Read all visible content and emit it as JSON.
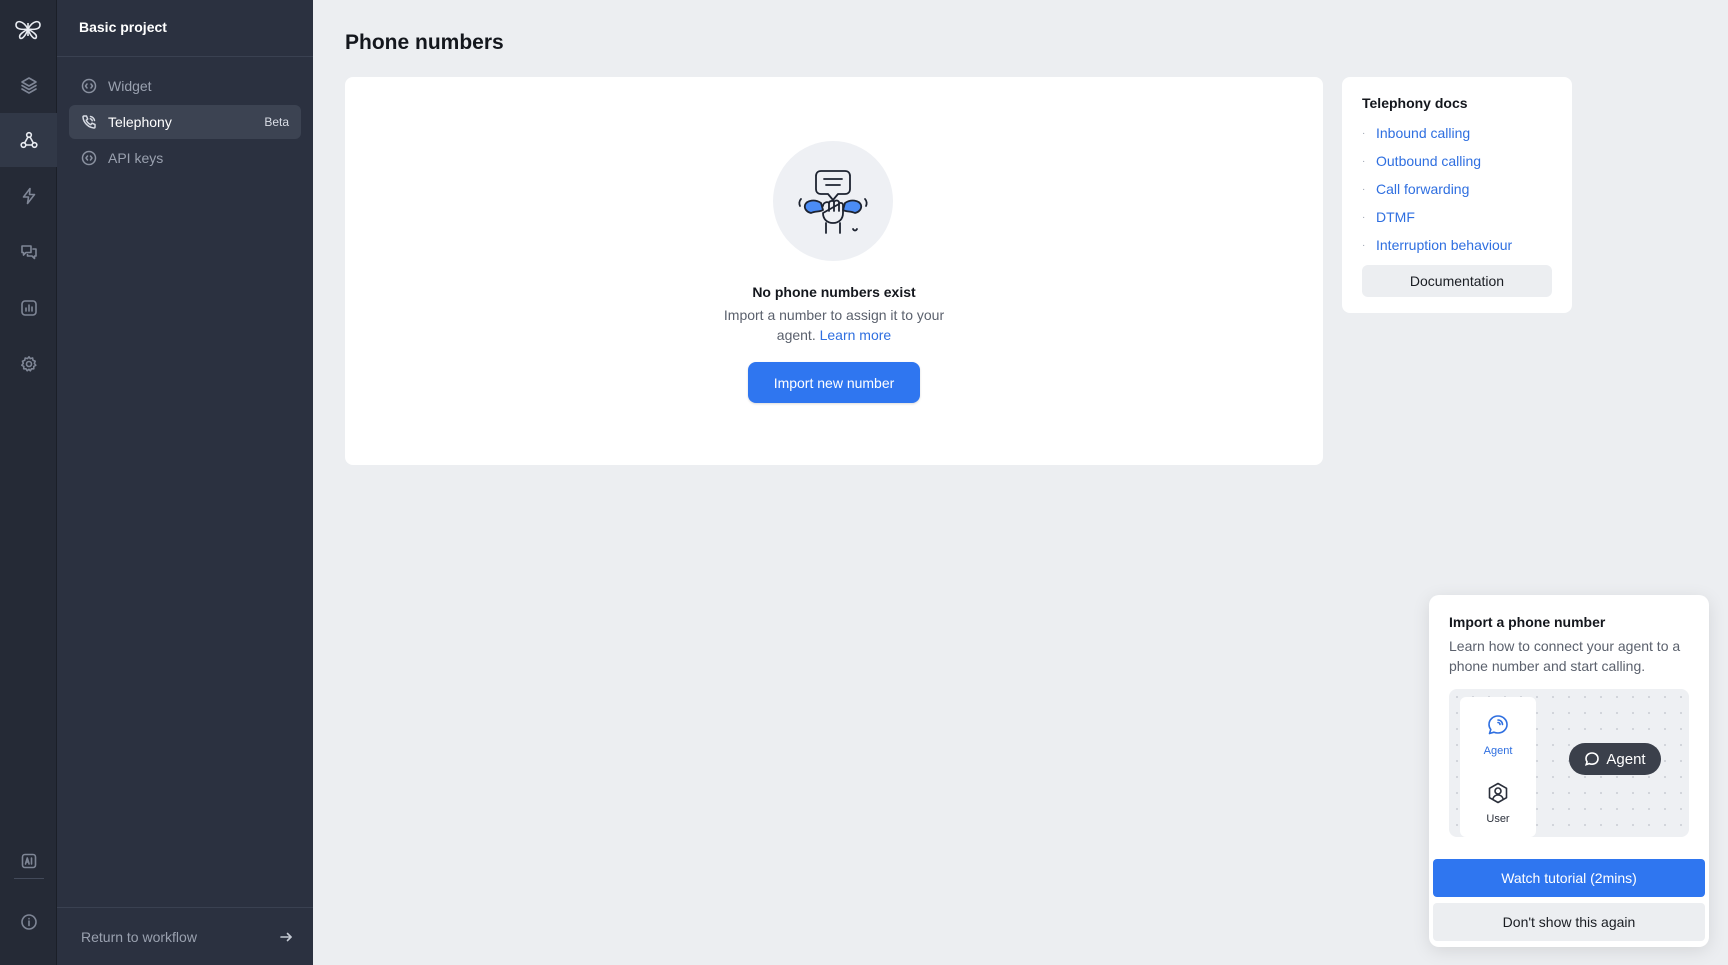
{
  "rail": {
    "logo_icon": "butterfly-logo-icon",
    "items": [
      {
        "icon": "layers-icon",
        "active": false
      },
      {
        "icon": "share-nodes-icon",
        "active": true
      },
      {
        "icon": "lightning-icon",
        "active": false
      },
      {
        "icon": "chat-bubbles-icon",
        "active": false
      },
      {
        "icon": "analytics-icon",
        "active": false
      },
      {
        "icon": "gear-icon",
        "active": false
      },
      {
        "icon": "ai-icon",
        "active": false
      },
      {
        "icon": "info-icon",
        "active": false
      }
    ]
  },
  "sidebar": {
    "project_title": "Basic project",
    "items": [
      {
        "label": "Widget",
        "icon": "widget-icon",
        "active": false
      },
      {
        "label": "Telephony",
        "icon": "phone-icon",
        "active": true,
        "badge": "Beta"
      },
      {
        "label": "API keys",
        "icon": "api-key-icon",
        "active": false
      }
    ],
    "return_label": "Return to workflow",
    "return_icon": "arrow-right-icon"
  },
  "main": {
    "title": "Phone numbers",
    "empty_state": {
      "illustration": "phone-conversation-icon",
      "title": "No phone numbers exist",
      "description": "Import a number to assign it to your agent.",
      "link": "Learn more",
      "button": "Import new number"
    }
  },
  "docs": {
    "title": "Telephony docs",
    "links": [
      "Inbound calling",
      "Outbound calling",
      "Call forwarding",
      "DTMF",
      "Interruption behaviour"
    ],
    "button": "Documentation"
  },
  "popup": {
    "title": "Import a phone number",
    "description": "Learn how to connect your agent to a phone number and start calling.",
    "preview": {
      "agent_label": "Agent",
      "user_label": "User",
      "chip_label": "Agent"
    },
    "watch_button": "Watch tutorial (2mins)",
    "dismiss_button": "Don't show this again"
  },
  "colors": {
    "accent": "#2f76f0",
    "link": "#2f6fe0",
    "rail_bg": "#252a36",
    "sidebar_bg": "#2b3140",
    "page_bg": "#eceef1"
  }
}
